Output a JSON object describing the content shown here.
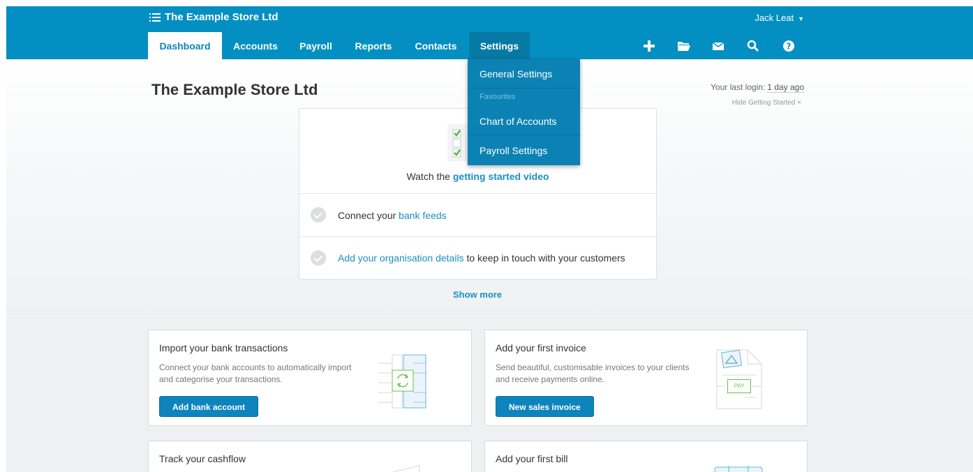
{
  "header": {
    "org_name": "The Example Store Ltd",
    "user_name": "Jack Leat",
    "tabs": [
      {
        "label": "Dashboard"
      },
      {
        "label": "Accounts"
      },
      {
        "label": "Payroll"
      },
      {
        "label": "Reports"
      },
      {
        "label": "Contacts"
      },
      {
        "label": "Settings"
      }
    ],
    "icons": [
      "plus-icon",
      "folder-icon",
      "mail-icon",
      "search-icon",
      "help-icon"
    ]
  },
  "settings_menu": {
    "general": "General Settings",
    "favourites": "Favourites",
    "chart_of_accounts": "Chart of Accounts",
    "payroll_settings": "Payroll Settings"
  },
  "page": {
    "title": "The Example Store Ltd",
    "last_login_label": "Your last login:",
    "last_login_value": "1 day ago",
    "hide_getting_started": "Hide Getting Started ×"
  },
  "getting_started": {
    "video_prefix": "Watch the",
    "video_link": "getting started video",
    "item1_prefix": "Connect your",
    "item1_link": "bank feeds",
    "item2_link": "Add your organisation details",
    "item2_suffix": "to keep in touch with your customers",
    "show_more": "Show more"
  },
  "cards": {
    "bank": {
      "title": "Import your bank transactions",
      "desc": "Connect your bank accounts to automatically import and categorise your transactions.",
      "button": "Add bank account"
    },
    "invoice": {
      "title": "Add your first invoice",
      "desc": "Send beautiful, customisable invoices to your clients and receive payments online.",
      "button": "New sales invoice",
      "pay_label": "PAY"
    },
    "cashflow": {
      "title": "Track your cashflow"
    },
    "bill": {
      "title": "Add your first bill"
    }
  },
  "colors": {
    "header": "#048fc2",
    "accent": "#1a8fc4",
    "button": "#0e84bd",
    "check_green": "#5fb33a"
  }
}
